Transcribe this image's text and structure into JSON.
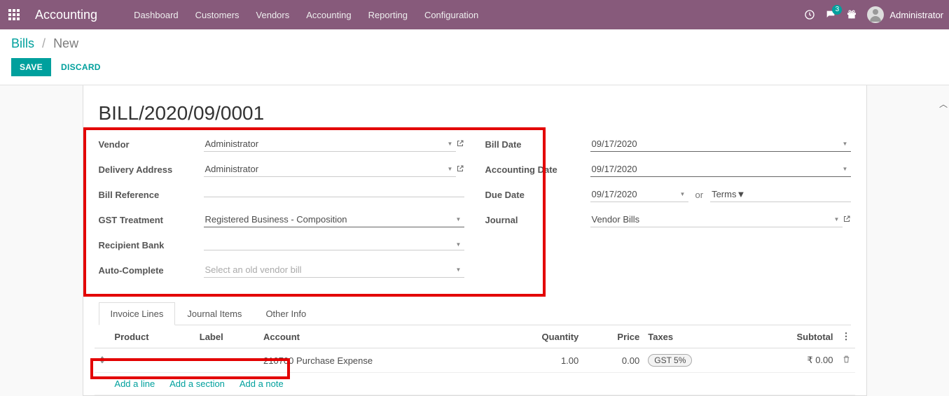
{
  "navbar": {
    "brand": "Accounting",
    "menu": [
      "Dashboard",
      "Customers",
      "Vendors",
      "Accounting",
      "Reporting",
      "Configuration"
    ],
    "msg_badge": "3",
    "user_name": "Administrator"
  },
  "breadcrumb": {
    "parent": "Bills",
    "current": "New"
  },
  "buttons": {
    "save": "SAVE",
    "discard": "DISCARD"
  },
  "bill": {
    "title": "BILL/2020/09/0001",
    "left_fields": {
      "vendor": {
        "label": "Vendor",
        "value": "Administrator"
      },
      "delivery": {
        "label": "Delivery Address",
        "value": "Administrator"
      },
      "bill_ref": {
        "label": "Bill Reference",
        "value": ""
      },
      "gst": {
        "label": "GST Treatment",
        "value": "Registered Business - Composition"
      },
      "bank": {
        "label": "Recipient Bank",
        "value": ""
      },
      "auto": {
        "label": "Auto-Complete",
        "placeholder": "Select an old vendor bill"
      }
    },
    "right_fields": {
      "bill_date": {
        "label": "Bill Date",
        "value": "09/17/2020"
      },
      "acct_date": {
        "label": "Accounting Date",
        "value": "09/17/2020"
      },
      "due_date": {
        "label": "Due Date",
        "value": "09/17/2020",
        "or": "or",
        "terms_placeholder": "Terms"
      },
      "journal": {
        "label": "Journal",
        "value": "Vendor Bills"
      }
    }
  },
  "tabs": [
    "Invoice Lines",
    "Journal Items",
    "Other Info"
  ],
  "table": {
    "headers": {
      "product": "Product",
      "label": "Label",
      "account": "Account",
      "quantity": "Quantity",
      "price": "Price",
      "taxes": "Taxes",
      "subtotal": "Subtotal"
    },
    "rows": [
      {
        "product": "",
        "label": "",
        "account": "210700 Purchase Expense",
        "quantity": "1.00",
        "price": "0.00",
        "taxes": "GST 5%",
        "subtotal": "₹ 0.00"
      }
    ],
    "add_line": "Add a line",
    "add_section": "Add a section",
    "add_note": "Add a note"
  }
}
